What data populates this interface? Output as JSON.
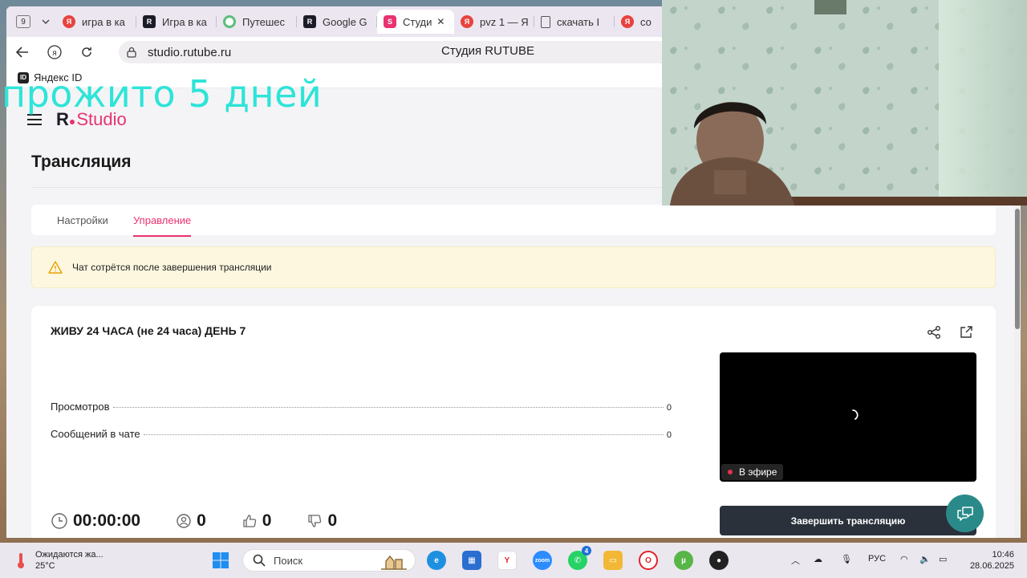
{
  "browser": {
    "tab_counter": "9",
    "tabs": [
      {
        "label": "игра в ка",
        "icon": "ya"
      },
      {
        "label": "Игра в ка",
        "icon": "r"
      },
      {
        "label": "Путешес",
        "icon": "trip"
      },
      {
        "label": "Google G",
        "icon": "r"
      },
      {
        "label": "Студи",
        "icon": "studio",
        "active": true
      },
      {
        "label": "pvz 1 — Я",
        "icon": "ya"
      },
      {
        "label": "скачать I",
        "icon": "doc"
      },
      {
        "label": "со",
        "icon": "ya"
      }
    ],
    "url": "studio.rutube.ru",
    "page_title": "Студия RUTUBE",
    "bookmark": "Яндекс ID",
    "id_badge": "ID"
  },
  "overlay": {
    "text": "прожито 5 дней"
  },
  "studio": {
    "logo_r": "R",
    "logo_studio": "Studio",
    "page_heading": "Трансляция",
    "tabs": [
      "Настройки",
      "Управление"
    ],
    "notice": "Чат сотрётся после завершения трансляции",
    "stream_title": "ЖИВУ 24 ЧАСА (не 24 часа) ДЕНЬ 7",
    "stats": [
      {
        "label": "Просмотров",
        "value": "0"
      },
      {
        "label": "Сообщений в чате",
        "value": "0"
      }
    ],
    "timer": "00:00:00",
    "viewers": "0",
    "likes": "0",
    "dislikes": "0",
    "live_label": "В эфире",
    "end_button": "Завершить трансляцию"
  },
  "taskbar": {
    "weather_title": "Ожидаются жа...",
    "weather_temp": "25°C",
    "search_placeholder": "Поиск",
    "zoom_label": "zoom",
    "whatsapp_badge": "4",
    "language": "РУС",
    "time": "10:46",
    "date": "28.06.2025"
  },
  "colors": {
    "accent": "#e8336f",
    "overlay_text": "#2ee4d8",
    "end_button": "#2a313a",
    "chat_fab": "#2a8a8a",
    "live_dot": "#e8334a"
  }
}
